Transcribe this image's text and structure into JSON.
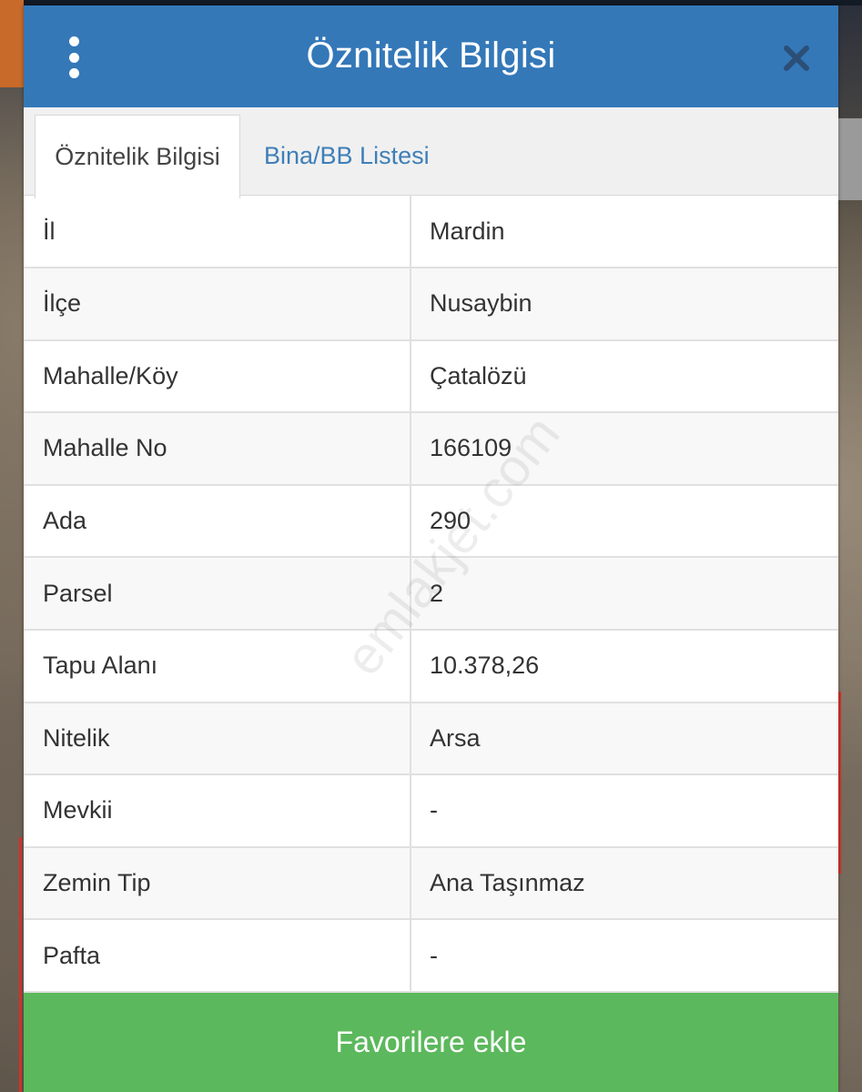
{
  "header": {
    "title": "Öznitelik Bilgisi"
  },
  "tabs": [
    {
      "label": "Öznitelik Bilgisi",
      "active": true
    },
    {
      "label": "Bina/BB Listesi",
      "active": false
    }
  ],
  "attributes": [
    {
      "key": "İl",
      "value": "Mardin"
    },
    {
      "key": "İlçe",
      "value": "Nusaybin"
    },
    {
      "key": "Mahalle/Köy",
      "value": "Çatalözü"
    },
    {
      "key": "Mahalle No",
      "value": "166109"
    },
    {
      "key": "Ada",
      "value": "290"
    },
    {
      "key": "Parsel",
      "value": "2"
    },
    {
      "key": "Tapu Alanı",
      "value": "10.378,26"
    },
    {
      "key": "Nitelik",
      "value": "Arsa"
    },
    {
      "key": "Mevkii",
      "value": "-"
    },
    {
      "key": "Zemin Tip",
      "value": "Ana Taşınmaz"
    },
    {
      "key": "Pafta",
      "value": "-"
    }
  ],
  "footer": {
    "button_label": "Favorilere ekle"
  },
  "watermark": "emlakjet.com",
  "icons": {
    "menu": "more-vertical-icon",
    "close": "close-icon"
  },
  "colors": {
    "header": "#3478b8",
    "tab_link": "#3e7fb8",
    "footer_button": "#5cb85c"
  }
}
